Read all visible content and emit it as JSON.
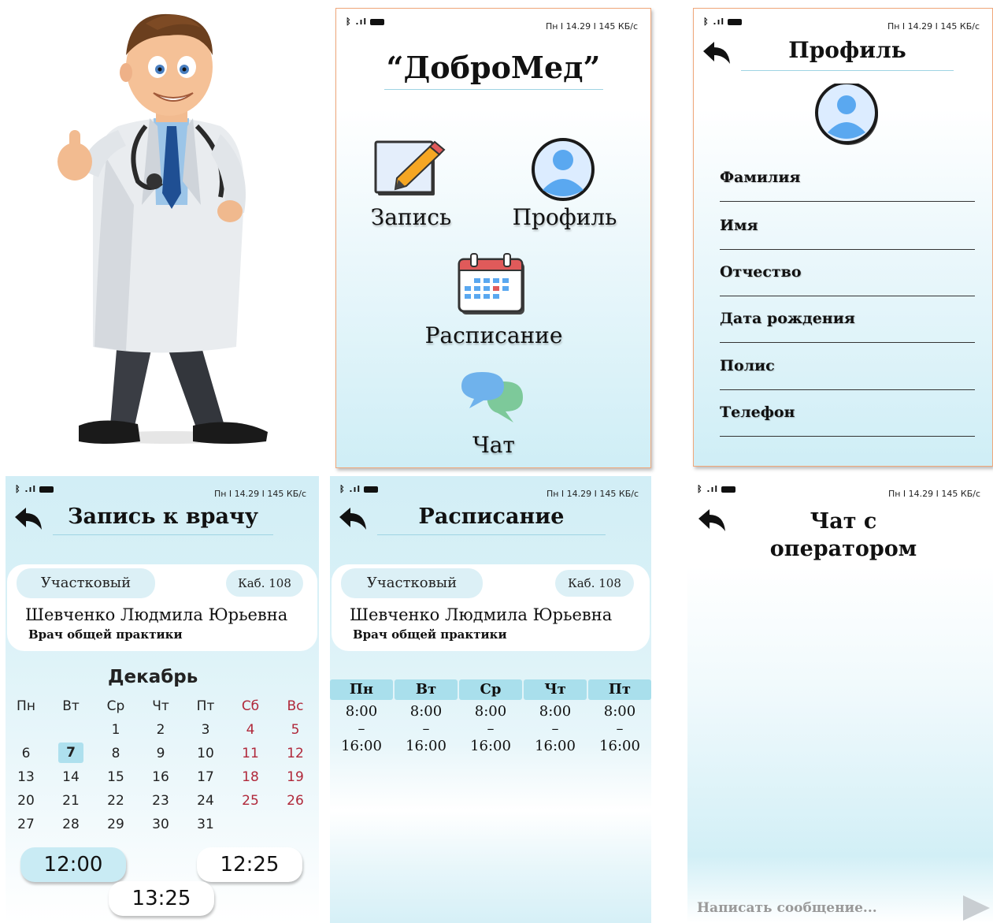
{
  "status_bar": {
    "signal": "ᛒ .ıl",
    "info": "Пн I 14.29 I 145 КБ/с"
  },
  "menu": {
    "app_title": "“ДоброМед”",
    "items": [
      {
        "label": "Запись",
        "icon": "edit-icon"
      },
      {
        "label": "Профиль",
        "icon": "user-icon"
      },
      {
        "label": "Расписание",
        "icon": "calendar-icon"
      },
      {
        "label": "Чат",
        "icon": "chat-icon"
      }
    ]
  },
  "profile": {
    "title": "Профиль",
    "fields": [
      "Фамилия",
      "Имя",
      "Отчество",
      "Дата рождения",
      "Полис",
      "Телефон"
    ]
  },
  "appointment": {
    "title": "Запись к врачу",
    "doctor_type": "Участковый",
    "room": "Каб. 108",
    "doctor_name": "Шевченко Людмила Юрьевна",
    "doctor_role": "Врач общей практики",
    "month": "Декабрь",
    "weekdays": [
      "Пн",
      "Вт",
      "Ср",
      "Чт",
      "Пт",
      "Сб",
      "Вс"
    ],
    "weeks": [
      [
        "",
        "",
        "1",
        "2",
        "3",
        "4",
        "5"
      ],
      [
        "6",
        "7",
        "8",
        "9",
        "10",
        "11",
        "12"
      ],
      [
        "13",
        "14",
        "15",
        "16",
        "17",
        "18",
        "19"
      ],
      [
        "20",
        "21",
        "22",
        "23",
        "24",
        "25",
        "26"
      ],
      [
        "27",
        "28",
        "29",
        "30",
        "31",
        "",
        ""
      ]
    ],
    "selected_day": "7",
    "times": [
      "12:00",
      "12:25",
      "13:25"
    ],
    "selected_time": "12:00",
    "colors": {
      "weekend": "#b0283a",
      "selected": "#aee0ee"
    }
  },
  "schedule": {
    "title": "Расписание",
    "doctor_type": "Участковый",
    "room": "Каб. 108",
    "doctor_name": "Шевченко Людмила Юрьевна",
    "doctor_role": "Врач общей практики",
    "days": [
      {
        "day": "Пн",
        "start": "8:00",
        "sep": "–",
        "end": "16:00"
      },
      {
        "day": "Вт",
        "start": "8:00",
        "sep": "–",
        "end": "16:00"
      },
      {
        "day": "Ср",
        "start": "8:00",
        "sep": "–",
        "end": "16:00"
      },
      {
        "day": "Чт",
        "start": "8:00",
        "sep": "–",
        "end": "16:00"
      },
      {
        "day": "Пт",
        "start": "8:00",
        "sep": "–",
        "end": "16:00"
      }
    ]
  },
  "chat": {
    "title_line1": "Чат с",
    "title_line2": "оператором",
    "placeholder": "Написать сообщение..."
  }
}
